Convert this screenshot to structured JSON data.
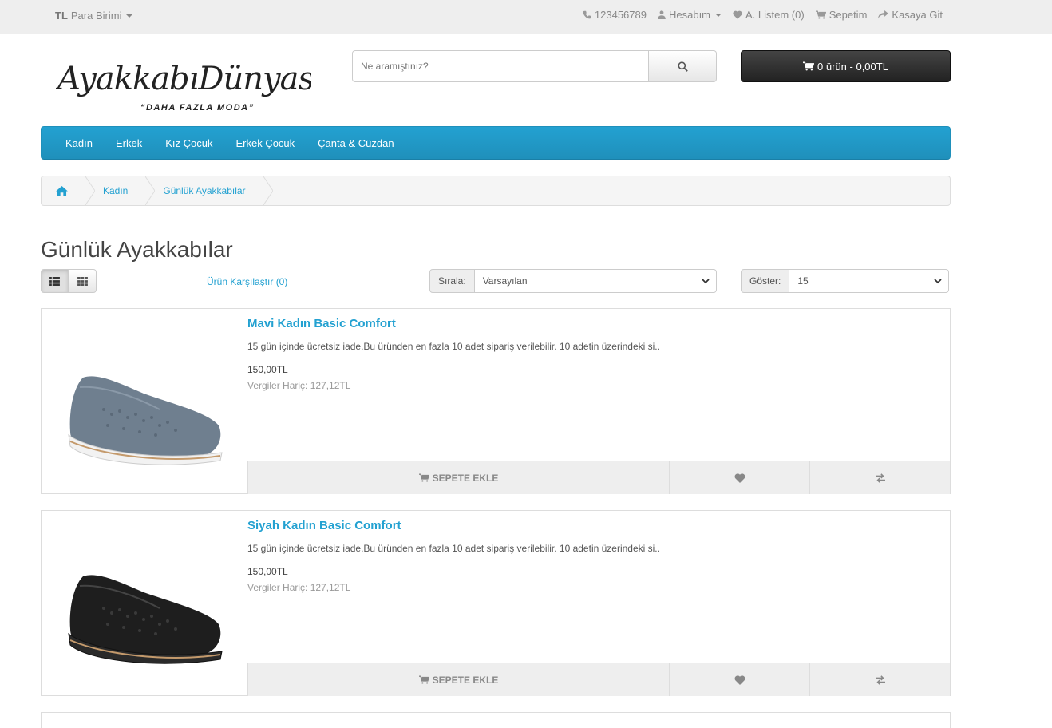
{
  "topbar": {
    "currency_symbol": "TL",
    "currency_label": "Para Birimi",
    "phone": "123456789",
    "account": "Hesabım",
    "wishlist": "A. Listem (0)",
    "cart": "Sepetim",
    "checkout": "Kasaya Git"
  },
  "header": {
    "logo_text": "AyakkabıDünyası",
    "logo_slogan": "“DAHA FAZLA MODA”",
    "search_placeholder": "Ne aramıştınız?",
    "cart_summary": "0 ürün - 0,00TL"
  },
  "menu": {
    "items": [
      "Kadın",
      "Erkek",
      "Kız Çocuk",
      "Erkek Çocuk",
      "Çanta & Cüzdan"
    ]
  },
  "breadcrumb": {
    "items": [
      "Kadın",
      "Günlük Ayakkabılar"
    ]
  },
  "page": {
    "title": "Günlük Ayakkabılar",
    "compare": "Ürün Karşılaştır (0)",
    "sort_label": "Sırala:",
    "sort_value": "Varsayılan",
    "show_label": "Göster:",
    "show_value": "15"
  },
  "products": [
    {
      "name": "Mavi Kadın Basic Comfort",
      "description": "15 gün içinde ücretsiz iade.Bu üründen en fazla 10 adet sipariş verilebilir. 10 adetin üzerindeki si..",
      "price": "150,00TL",
      "tax": "Vergiler Hariç: 127,12TL",
      "add_label": "SEPETE EKLE",
      "shoe_color": "#6f7f8f"
    },
    {
      "name": "Siyah Kadın Basic Comfort",
      "description": "15 gün içinde ücretsiz iade.Bu üründen en fazla 10 adet sipariş verilebilir. 10 adetin üzerindeki si..",
      "price": "150,00TL",
      "tax": "Vergiler Hariç: 127,12TL",
      "add_label": "SEPETE EKLE",
      "shoe_color": "#1e1e1e"
    }
  ],
  "colors": {
    "accent": "#23a1d1",
    "topbar_bg": "#eeeeee",
    "cart_button": "#303030"
  }
}
